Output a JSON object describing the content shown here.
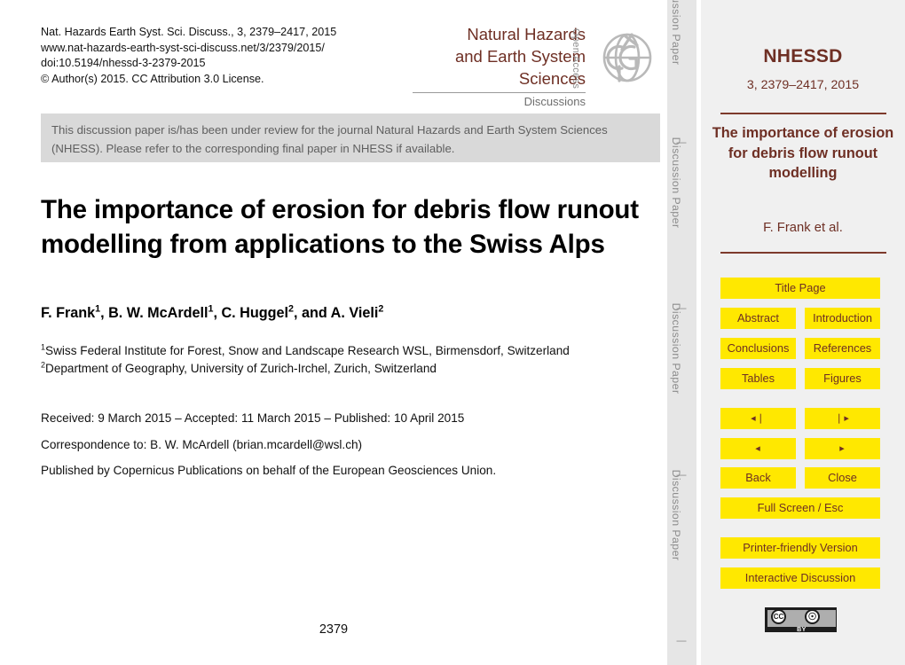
{
  "masthead": {
    "lines": [
      "Nat. Hazards Earth Syst. Sci. Discuss., 3, 2379–2417, 2015",
      "www.nat-hazards-earth-syst-sci-discuss.net/3/2379/2015/",
      "doi:10.5194/nhessd-3-2379-2015",
      "© Author(s) 2015. CC Attribution 3.0 License."
    ]
  },
  "journal_logo": {
    "name_line1": "Natural Hazards",
    "name_line2": "and Earth System",
    "name_line3": "Sciences",
    "subtitle": "Discussions",
    "open_access": "Open Access",
    "logo_name": "egu-logo",
    "brand_color": "#6e2f24"
  },
  "notice": {
    "text": "This discussion paper is/has been under review for the journal Natural Hazards and Earth System Sciences (NHESS). Please refer to the corresponding final paper in NHESS if available.",
    "background": "#d9d9d9"
  },
  "paper": {
    "title": "The importance of erosion for debris flow runout modelling from applications to the Swiss Alps",
    "authors_html": "F. Frank<sup>1</sup>, B. W. McArdell<sup>1</sup>, C. Huggel<sup>2</sup>, and A. Vieli<sup>2</sup>",
    "affiliation1": "<sup>1</sup>Swiss Federal Institute for Forest, Snow and Landscape Research WSL, Birmensdorf, Switzerland",
    "affiliation2": "<sup>2</sup>Department of Geography, University of Zurich-Irchel, Zurich, Switzerland",
    "received": "Received: 9 March 2015 – Accepted: 11 March 2015 – Published: 10 April 2015",
    "correspondence": "Correspondence to: B. W. McArdell (brian.mcardell@wsl.ch)",
    "publisher": "Published by Copernicus Publications on behalf of the European Geosciences Union.",
    "page_number": "2379"
  },
  "side_band": {
    "label": "Discussion Paper",
    "separator": "|",
    "repeat_count": 4
  },
  "sidebar": {
    "journal_abbrev": "NHESSD",
    "issue": "3, 2379–2417, 2015",
    "title": "The importance of erosion for debris flow runout modelling",
    "authors": "F. Frank et al.",
    "accent_color": "#6e2f24",
    "button_color": "#ffe800",
    "buttons": {
      "title_page": "Title Page",
      "abstract": "Abstract",
      "introduction": "Introduction",
      "conclusions": "Conclusions",
      "references": "References",
      "tables": "Tables",
      "figures": "Figures",
      "first_page": "◂❘",
      "last_page": "❘▸",
      "prev_page": "◂",
      "next_page": "▸",
      "back": "Back",
      "close": "Close",
      "full_screen": "Full Screen / Esc",
      "printer_friendly": "Printer-friendly Version",
      "interactive_discussion": "Interactive Discussion"
    },
    "license_badge": {
      "cc": "CC",
      "person": "\u0001",
      "by": "BY"
    }
  }
}
